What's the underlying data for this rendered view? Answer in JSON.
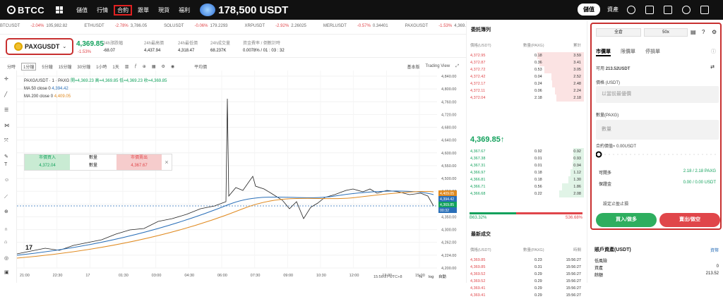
{
  "topbar": {
    "logo": "BTCC",
    "nav": [
      "儲值",
      "行情",
      "合約",
      "跟單",
      "現貨",
      "福利"
    ],
    "promo_amount": "178,500 USDT",
    "deposit": "儲值",
    "assets": "資產"
  },
  "tickers": [
    {
      "sym": "BTCUSDT",
      "chg": "-2.04%",
      "price": "105,982.82"
    },
    {
      "sym": "ETHUSDT",
      "chg": "-2.78%",
      "price": "3,786.05"
    },
    {
      "sym": "SOLUSDT",
      "chg": "-0.06%",
      "price": "179.2293"
    },
    {
      "sym": "XRPUSDT",
      "chg": "-2.92%",
      "price": "2.26025"
    },
    {
      "sym": "MERLUSDT",
      "chg": "-0.57%",
      "price": "0.34401"
    },
    {
      "sym": "PAXGUSDT",
      "chg": "-1.53%",
      "price": "4,369.85"
    },
    {
      "sym": "ZEI",
      "chg": "",
      "price": ""
    }
  ],
  "pair": {
    "name": "PAXGUSDT",
    "last": "4,369.85",
    "chg": "-1.53%",
    "stats": [
      {
        "k": "24h漲跌幅",
        "v": "-68.07"
      },
      {
        "k": "24h最高價",
        "v": "4,437.94"
      },
      {
        "k": "24h最低價",
        "v": "4,318.47"
      },
      {
        "k": "24h成交量",
        "v": "68.237K"
      },
      {
        "k": "資金費率 / 倒數計時",
        "v": "0.0078% / 01 : 03 : 32"
      }
    ]
  },
  "toolbar": {
    "timeframes": [
      "分時",
      "1分鐘",
      "5分鐘",
      "15分鐘",
      "30分鐘",
      "1小時",
      "1天"
    ],
    "indicator": "平均價",
    "basic": "基本版",
    "tv": "Trading View"
  },
  "legend": {
    "title": "PAXG/USDT · 1 · PAXG",
    "ohlc": "開=4,369.23 高=4,369.85 低=4,369.23 收=4,369.85",
    "ma50": "MA 50 close 0",
    "ma50v": "4,394.42",
    "ma200": "MA 200 close 0",
    "ma200v": "4,409.05"
  },
  "popup": {
    "buy": "市價買入",
    "buy_price": "4,372.04",
    "qty": "數量",
    "qty2": "數量",
    "sell": "市價賣出",
    "sell_price": "4,367.67",
    "close": "×"
  },
  "chart_data": {
    "type": "line",
    "y_ticks": [
      "4,840.00",
      "4,800.00",
      "4,760.00",
      "4,720.00",
      "4,680.00",
      "4,640.00",
      "4,600.00",
      "4,550.00",
      "4,500.00",
      "4,450.00",
      "4,400.00",
      "4,350.00",
      "4,300.00",
      "4,262.00",
      "4,224.00",
      "4,200.00"
    ],
    "x_ticks": [
      "21:00",
      "22:30",
      "17",
      "01:30",
      "03:00",
      "04:30",
      "06:00",
      "07:30",
      "09:00",
      "10:30",
      "12:00",
      "13:30",
      "15:00"
    ],
    "price_tags": [
      "4,409.05",
      "4,394.42",
      "4,369.85",
      "00:32"
    ],
    "time_label": "15:56:27 UTC+8",
    "scale": [
      "%",
      "log",
      "自動"
    ]
  },
  "orderbook": {
    "title": "委託簿列",
    "headers": [
      "價格(USDT)",
      "數量(PAXG)",
      "累計"
    ],
    "asks": [
      {
        "p": "4,372.95",
        "q": "0.18",
        "t": "3.59",
        "w": 0.95
      },
      {
        "p": "4,372.87",
        "q": "0.36",
        "t": "3.41",
        "w": 0.9
      },
      {
        "p": "4,372.72",
        "q": "0.53",
        "t": "3.05",
        "w": 0.8
      },
      {
        "p": "4,372.42",
        "q": "0.04",
        "t": "2.52",
        "w": 0.66
      },
      {
        "p": "4,372.17",
        "q": "0.24",
        "t": "2.48",
        "w": 0.65
      },
      {
        "p": "4,372.11",
        "q": "0.06",
        "t": "2.24",
        "w": 0.58
      },
      {
        "p": "4,372.04",
        "q": "2.18",
        "t": "2.18",
        "w": 0.56
      }
    ],
    "mid": "4,369.85↑",
    "bids": [
      {
        "p": "4,367.67",
        "q": "0.92",
        "t": "0.92",
        "w": 0.22
      },
      {
        "p": "4,367.38",
        "q": "0.01",
        "t": "0.93",
        "w": 0.22
      },
      {
        "p": "4,367.31",
        "q": "0.01",
        "t": "0.94",
        "w": 0.23
      },
      {
        "p": "4,366.97",
        "q": "0.18",
        "t": "1.12",
        "w": 0.27
      },
      {
        "p": "4,366.81",
        "q": "0.18",
        "t": "1.30",
        "w": 0.31
      },
      {
        "p": "4,366.71",
        "q": "0.56",
        "t": "1.86",
        "w": 0.45
      },
      {
        "p": "4,366.68",
        "q": "0.22",
        "t": "2.08",
        "w": 0.5
      }
    ],
    "ratio_buy": "B63.32%",
    "ratio_sell": "S36.68%",
    "trades_title": "最新成交",
    "trade_headers": [
      "價格(USDT)",
      "數量(PAXG)",
      "時間"
    ],
    "trades": [
      {
        "p": "4,369.85",
        "q": "0.23",
        "t": "15:56:27"
      },
      {
        "p": "4,369.85",
        "q": "0.31",
        "t": "15:56:27"
      },
      {
        "p": "4,369.52",
        "q": "0.29",
        "t": "15:56:27"
      },
      {
        "p": "4,369.52",
        "q": "0.29",
        "t": "15:56:27"
      },
      {
        "p": "4,369.41",
        "q": "0.29",
        "t": "15:56:27"
      },
      {
        "p": "4,369.41",
        "q": "0.29",
        "t": "15:56:27"
      }
    ]
  },
  "order": {
    "margin_mode": "全倉",
    "leverage": "50x",
    "tabs": [
      "市價單",
      "限價單",
      "停損單"
    ],
    "available_label": "可用",
    "available": "213.52USDT",
    "price_label": "價格 (USDT)",
    "price_placeholder": "以當前最優價",
    "qty_label": "數量(PAXG)",
    "qty_placeholder": "數量",
    "margin_label": "合約價值≈",
    "margin_value": "0.00USDT",
    "kv": [
      {
        "k": "可開多",
        "v": "2.18 / 2.18 PAXG"
      },
      {
        "k": "保證金",
        "v": "0.00 / 0.00 USDT"
      }
    ],
    "tpsl": "設定止盈止損",
    "buy": "買入/做多",
    "sell": "賣出/做空"
  },
  "account": {
    "title": "賬戶資產(USDT)",
    "link": "資幣",
    "rows": [
      {
        "k": "低風險",
        "v": ""
      },
      {
        "k": "資產",
        "v": "0"
      },
      {
        "k": "餘額",
        "v": "213.52"
      }
    ]
  }
}
